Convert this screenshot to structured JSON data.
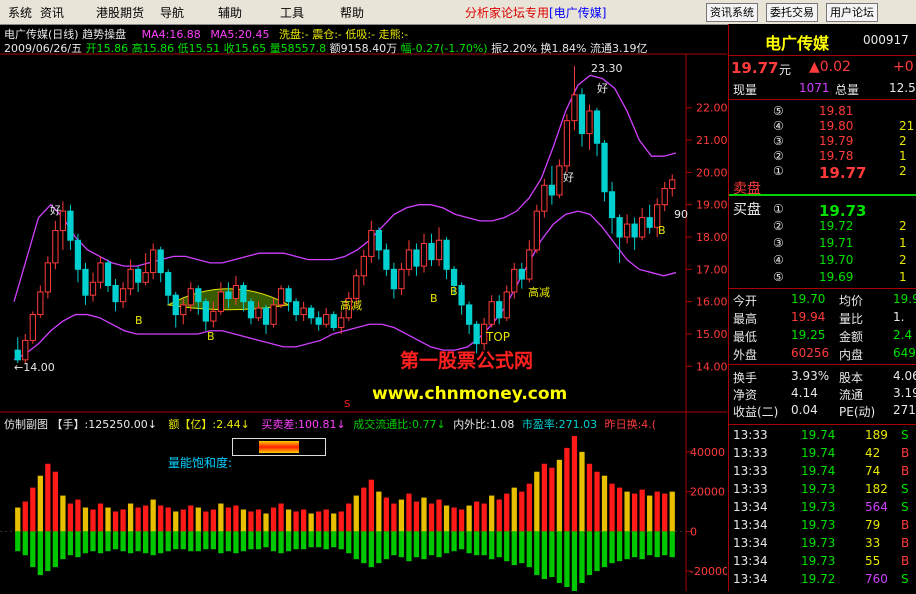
{
  "menu": {
    "items": [
      "系统",
      "资讯",
      "港股期货",
      "导航",
      "辅助",
      "工具",
      "帮助"
    ],
    "promo": "分析家论坛专用",
    "promo_stock": "[电广传媒]",
    "buttons": [
      "资讯系统",
      "委托交易",
      "用户论坛"
    ]
  },
  "colors": {
    "up": "#ff3b3b",
    "down": "#00d0d0",
    "band": "#d040ff",
    "volume_up": "#ff1a1a",
    "volume_down": "#00c800",
    "accent_yellow": "#e8e800"
  },
  "main_chart": {
    "title": "电广传媒(日线)",
    "indicator": "趋势操盘",
    "ma4": "MA4:16.88",
    "ma5": "MA5:20.45",
    "wash": "洗盘:-",
    "shake": "震仓:-",
    "low_absorb": "低吸:-",
    "rally": "走熊:-",
    "ohlc_line_date": "2009/06/26/五",
    "ohlc_open": "开15.86",
    "ohlc_high": "高15.86",
    "ohlc_low": "低15.51",
    "ohlc_close": "收15.65",
    "ohlc_vol": "量58557.8",
    "ohlc_amount": "额9158.40万",
    "ohlc_change": "幅-0.27(-1.70%)",
    "ohlc_amp": "振2.20%",
    "ohlc_turn": "换1.84%",
    "ohlc_float": "流通3.19亿",
    "y_ticks": [
      "22.00",
      "21.00",
      "20.00",
      "19.00",
      "18.00",
      "17.00",
      "16.00",
      "15.00",
      "14.00"
    ],
    "annotations": {
      "low_label": "←14.00",
      "high_label": "23.30",
      "top_label": "TOP",
      "cut1": "高减",
      "cut2": "高减",
      "good": "好",
      "b_marker": "B",
      "ninety": "90"
    },
    "watermark1": "第一股票公式网",
    "watermark2": "www.chnmoney.com"
  },
  "sub_chart": {
    "title": "仿制副图",
    "hand_label": "【手】:125250.00↓",
    "amount_label": "额【亿】:2.44↓",
    "buy_sell_diff": "买卖差:100.81↓",
    "turnover_ratio": "成交流通比:0.77↓",
    "in_out_ratio": "内外比:1.08",
    "pe": "市盈率:271.03",
    "yesterday": "昨日换:4.(",
    "saturation": "量能饱和度:",
    "s_marker": "S",
    "y_ticks": [
      "40000",
      "20000",
      "0",
      "-20000"
    ]
  },
  "quote": {
    "name": "电广传媒",
    "code": "000917",
    "price": "19.77",
    "unit": "元",
    "change": "▲0.02",
    "change_pct": "+0",
    "now_vol_label": "现量",
    "now_vol": "1071",
    "total_vol_label": "总量",
    "total_vol": "12.5",
    "asks": [
      {
        "lvl": "⑤",
        "price": "19.81",
        "vol": ""
      },
      {
        "lvl": "④",
        "price": "19.80",
        "vol": "21"
      },
      {
        "lvl": "③",
        "price": "19.79",
        "vol": "2"
      },
      {
        "lvl": "②",
        "price": "19.78",
        "vol": "1"
      },
      {
        "lvl": "①",
        "price": "19.77",
        "vol": "2"
      }
    ],
    "ask_label": "卖盘",
    "bid_label": "买盘",
    "bids": [
      {
        "lvl": "①",
        "price": "19.73",
        "vol": ""
      },
      {
        "lvl": "②",
        "price": "19.72",
        "vol": "2"
      },
      {
        "lvl": "③",
        "price": "19.71",
        "vol": "1"
      },
      {
        "lvl": "④",
        "price": "19.70",
        "vol": "2"
      },
      {
        "lvl": "⑤",
        "price": "19.69",
        "vol": "1"
      }
    ],
    "stats": [
      {
        "l1": "今开",
        "v1": "19.70",
        "l2": "均价",
        "v2": "19.9"
      },
      {
        "l1": "最高",
        "v1": "19.94",
        "l2": "量比",
        "v2": "1."
      },
      {
        "l1": "最低",
        "v1": "19.25",
        "l2": "金额",
        "v2": "2.4"
      },
      {
        "l1": "外盘",
        "v1": "60256",
        "l2": "内盘",
        "v2": "649"
      }
    ],
    "stats2": [
      {
        "l1": "换手",
        "v1": "3.93%",
        "l2": "股本",
        "v2": "4.06"
      },
      {
        "l1": "净资",
        "v1": "4.14",
        "l2": "流通",
        "v2": "3.19"
      },
      {
        "l1": "收益(二)",
        "v1": "0.04",
        "l2": "PE(动)",
        "v2": "271"
      }
    ],
    "ticks": [
      {
        "t": "13:33",
        "p": "19.74",
        "v": "189",
        "s": "S"
      },
      {
        "t": "13:33",
        "p": "19.74",
        "v": "42",
        "s": "B"
      },
      {
        "t": "13:33",
        "p": "19.74",
        "v": "74",
        "s": "B"
      },
      {
        "t": "13:33",
        "p": "19.73",
        "v": "182",
        "s": "S"
      },
      {
        "t": "13:34",
        "p": "19.73",
        "v": "564",
        "s": "S"
      },
      {
        "t": "13:34",
        "p": "19.73",
        "v": "79",
        "s": "B"
      },
      {
        "t": "13:34",
        "p": "19.73",
        "v": "33",
        "s": "B"
      },
      {
        "t": "13:34",
        "p": "19.73",
        "v": "55",
        "s": "B"
      },
      {
        "t": "13:34",
        "p": "19.72",
        "v": "760",
        "s": "S"
      }
    ]
  },
  "chart_data": {
    "type": "candlestick",
    "title": "电广传媒(日线)",
    "ylim": [
      13.7,
      23.6
    ],
    "sub_ylim": [
      -30000,
      52000
    ],
    "candles": [
      [
        14.5,
        14.2,
        14.9,
        14.1
      ],
      [
        14.2,
        14.8,
        15.0,
        14.1
      ],
      [
        14.8,
        15.6,
        15.7,
        14.7
      ],
      [
        15.6,
        16.3,
        16.5,
        15.5
      ],
      [
        16.3,
        17.2,
        17.4,
        16.1
      ],
      [
        17.2,
        18.2,
        18.5,
        17.0
      ],
      [
        18.2,
        18.8,
        19.1,
        17.6
      ],
      [
        18.8,
        17.9,
        19.0,
        17.6
      ],
      [
        17.9,
        17.0,
        18.1,
        16.6
      ],
      [
        17.0,
        16.2,
        17.2,
        15.9
      ],
      [
        16.2,
        16.6,
        16.9,
        16.0
      ],
      [
        16.6,
        17.2,
        17.4,
        16.4
      ],
      [
        17.2,
        16.5,
        17.3,
        16.3
      ],
      [
        16.5,
        16.0,
        16.7,
        15.7
      ],
      [
        16.0,
        16.4,
        16.6,
        15.8
      ],
      [
        16.4,
        17.0,
        17.3,
        16.2
      ],
      [
        17.0,
        16.6,
        17.1,
        16.3
      ],
      [
        16.6,
        16.9,
        17.5,
        16.5
      ],
      [
        16.9,
        17.6,
        17.8,
        16.7
      ],
      [
        17.6,
        16.9,
        17.7,
        16.6
      ],
      [
        16.9,
        16.2,
        17.0,
        15.9
      ],
      [
        16.2,
        15.6,
        16.3,
        15.2
      ],
      [
        15.6,
        15.9,
        16.1,
        15.3
      ],
      [
        15.9,
        16.4,
        16.6,
        15.7
      ],
      [
        16.4,
        16.0,
        16.5,
        15.6
      ],
      [
        16.0,
        15.4,
        16.1,
        15.1
      ],
      [
        15.4,
        15.7,
        16.0,
        15.2
      ],
      [
        15.7,
        16.3,
        16.6,
        15.6
      ],
      [
        16.3,
        16.1,
        16.6,
        15.8
      ],
      [
        16.1,
        16.5,
        16.8,
        15.9
      ],
      [
        16.5,
        16.0,
        16.6,
        15.7
      ],
      [
        16.0,
        15.5,
        16.1,
        15.3
      ],
      [
        15.5,
        15.8,
        16.0,
        15.4
      ],
      [
        15.8,
        15.3,
        15.9,
        15.0
      ],
      [
        15.3,
        15.9,
        16.1,
        15.2
      ],
      [
        15.9,
        16.4,
        16.5,
        15.8
      ],
      [
        16.4,
        16.0,
        16.5,
        15.7
      ],
      [
        16.0,
        15.6,
        16.1,
        15.4
      ],
      [
        15.6,
        15.8,
        16.0,
        15.4
      ],
      [
        15.8,
        15.5,
        15.9,
        15.3
      ],
      [
        15.5,
        15.3,
        15.7,
        15.1
      ],
      [
        15.3,
        15.6,
        15.8,
        15.2
      ],
      [
        15.6,
        15.2,
        15.7,
        15.1
      ],
      [
        15.2,
        15.5,
        15.7,
        15.0
      ],
      [
        15.5,
        16.1,
        16.3,
        15.4
      ],
      [
        16.1,
        16.8,
        17.0,
        15.9
      ],
      [
        16.8,
        17.4,
        17.6,
        16.5
      ],
      [
        17.4,
        18.2,
        18.5,
        17.2
      ],
      [
        18.2,
        17.6,
        18.3,
        17.3
      ],
      [
        17.6,
        17.0,
        17.8,
        16.8
      ],
      [
        17.0,
        16.4,
        17.2,
        16.1
      ],
      [
        16.4,
        17.0,
        17.2,
        16.2
      ],
      [
        17.0,
        17.6,
        17.9,
        16.8
      ],
      [
        17.6,
        17.1,
        17.8,
        16.8
      ],
      [
        17.1,
        17.8,
        18.1,
        16.9
      ],
      [
        17.8,
        17.3,
        18.1,
        17.1
      ],
      [
        17.3,
        17.9,
        18.3,
        17.1
      ],
      [
        17.9,
        17.0,
        18.0,
        16.7
      ],
      [
        17.0,
        16.5,
        17.1,
        16.2
      ],
      [
        16.5,
        15.9,
        16.6,
        15.6
      ],
      [
        15.9,
        15.3,
        16.0,
        15.0
      ],
      [
        15.3,
        14.7,
        15.4,
        14.4
      ],
      [
        14.7,
        15.3,
        15.5,
        14.5
      ],
      [
        15.3,
        16.0,
        16.2,
        15.2
      ],
      [
        16.0,
        15.5,
        16.2,
        15.3
      ],
      [
        15.5,
        16.3,
        16.5,
        15.4
      ],
      [
        16.3,
        17.0,
        17.2,
        16.1
      ],
      [
        17.0,
        16.7,
        17.2,
        16.4
      ],
      [
        16.7,
        17.6,
        17.9,
        16.6
      ],
      [
        17.6,
        18.8,
        19.0,
        17.5
      ],
      [
        18.8,
        19.6,
        19.8,
        18.6
      ],
      [
        19.6,
        19.3,
        20.2,
        19.0
      ],
      [
        19.3,
        20.2,
        20.4,
        19.2
      ],
      [
        20.2,
        21.6,
        21.8,
        20.0
      ],
      [
        21.6,
        22.4,
        23.3,
        21.3
      ],
      [
        22.4,
        21.2,
        22.6,
        20.8
      ],
      [
        21.2,
        21.9,
        22.1,
        20.7
      ],
      [
        21.9,
        20.9,
        22.0,
        20.5
      ],
      [
        20.9,
        19.4,
        21.0,
        19.1
      ],
      [
        19.4,
        18.6,
        19.7,
        18.1
      ],
      [
        18.6,
        18.0,
        18.7,
        17.2
      ],
      [
        18.0,
        18.4,
        18.7,
        17.8
      ],
      [
        18.4,
        18.0,
        18.6,
        17.6
      ],
      [
        18.0,
        18.6,
        18.9,
        17.9
      ],
      [
        18.6,
        18.3,
        19.0,
        18.1
      ],
      [
        18.3,
        19.0,
        19.2,
        18.0
      ],
      [
        19.0,
        19.5,
        19.7,
        18.8
      ],
      [
        19.5,
        19.77,
        19.94,
        19.25
      ]
    ],
    "upper_band": [
      16.0,
      17.3,
      18.6,
      19.0,
      18.6,
      18.0,
      17.6,
      17.4,
      17.2,
      17.1,
      17.1,
      17.2,
      17.3,
      17.4,
      17.4,
      17.3,
      17.2,
      17.2,
      17.3,
      17.4,
      17.5,
      17.5,
      17.5,
      17.4,
      17.3,
      17.3,
      17.3,
      17.4,
      17.6,
      17.9,
      18.3,
      18.7,
      18.9,
      19.0,
      19.0,
      18.9,
      18.7,
      18.6,
      18.5,
      18.5,
      18.6,
      18.8,
      19.2,
      19.8,
      20.8,
      21.9,
      22.7,
      23.0,
      22.9,
      22.6,
      21.9,
      21.0,
      20.5,
      20.5,
      20.6
    ],
    "lower_band": [
      14.2,
      14.4,
      14.7,
      15.1,
      15.4,
      15.6,
      15.6,
      15.5,
      15.3,
      15.1,
      15.0,
      15.0,
      15.0,
      15.0,
      15.0,
      15.0,
      15.1,
      15.1,
      15.0,
      14.9,
      14.8,
      14.7,
      14.6,
      14.6,
      14.7,
      14.8,
      15.0,
      15.1,
      15.2,
      15.3,
      15.3,
      15.2,
      15.0,
      14.8,
      14.6,
      14.5,
      14.5,
      14.6,
      14.9,
      15.3,
      15.8,
      16.5,
      17.2,
      17.9,
      18.4,
      18.7,
      18.8,
      18.7,
      18.3,
      17.8,
      17.3,
      17.0,
      16.9,
      16.8,
      16.9
    ],
    "volume": [
      12000,
      15000,
      22000,
      28000,
      34000,
      30000,
      18000,
      14000,
      16000,
      12000,
      11000,
      14000,
      12000,
      10000,
      11000,
      14000,
      12000,
      13000,
      16000,
      13000,
      12000,
      10000,
      11000,
      13000,
      12000,
      10000,
      11000,
      14000,
      12000,
      13000,
      11000,
      10000,
      11000,
      9000,
      12000,
      14000,
      11000,
      10000,
      11000,
      9000,
      10000,
      11000,
      9000,
      10000,
      14000,
      18000,
      22000,
      26000,
      20000,
      17000,
      14000,
      16000,
      19000,
      15000,
      17000,
      14000,
      16000,
      13000,
      12000,
      11000,
      13000,
      15000,
      14000,
      18000,
      16000,
      19000,
      22000,
      20000,
      24000,
      30000,
      34000,
      32000,
      36000,
      42000,
      48000,
      40000,
      34000,
      30000,
      28000,
      24000,
      22000,
      20000,
      19000,
      21000,
      18000,
      20000,
      19000,
      20000
    ],
    "neg_volume": [
      -10000,
      -12000,
      -18000,
      -22000,
      -20000,
      -18000,
      -14000,
      -12000,
      -13000,
      -11000,
      -10000,
      -11000,
      -10000,
      -9000,
      -10000,
      -11000,
      -10000,
      -11000,
      -12000,
      -11000,
      -10000,
      -9000,
      -9000,
      -10000,
      -10000,
      -9000,
      -9000,
      -11000,
      -10000,
      -11000,
      -10000,
      -9000,
      -9000,
      -8000,
      -10000,
      -11000,
      -10000,
      -9000,
      -9000,
      -8000,
      -8000,
      -9000,
      -8000,
      -9000,
      -11000,
      -14000,
      -16000,
      -18000,
      -16000,
      -14000,
      -12000,
      -13000,
      -15000,
      -13000,
      -14000,
      -12000,
      -13000,
      -11000,
      -10000,
      -9000,
      -11000,
      -12000,
      -12000,
      -14000,
      -13000,
      -15000,
      -17000,
      -16000,
      -18000,
      -22000,
      -24000,
      -23000,
      -26000,
      -28000,
      -30000,
      -26000,
      -22000,
      -20000,
      -18000,
      -16000,
      -15000,
      -14000,
      -13000,
      -14000,
      -12000,
      -13000,
      -12000,
      -13000
    ]
  }
}
